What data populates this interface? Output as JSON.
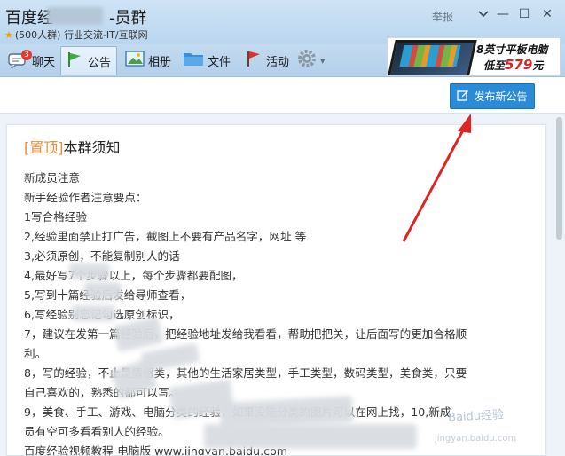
{
  "window": {
    "title_prefix": "百度经",
    "title_suffix": "-员群",
    "group_info": "(500人群) 行业交流-IT/互联网",
    "report_label": "举报",
    "minimize_glyph": "—",
    "maximize_glyph": "☐",
    "close_glyph": "✕"
  },
  "toolbar": {
    "tabs": [
      {
        "label": "聊天",
        "badge": "3"
      },
      {
        "label": "公告"
      },
      {
        "label": "相册"
      },
      {
        "label": "文件"
      },
      {
        "label": "活动"
      }
    ],
    "settings_dropdown_glyph": "▾"
  },
  "ad": {
    "line1": "8英寸平板电脑",
    "line2_prefix": "低至",
    "line2_price": "579",
    "line2_suffix": "元"
  },
  "announcement": {
    "publish_button": "发布新公告",
    "pin_tag": "[置顶]",
    "title": "本群须知",
    "lines": [
      "新成员注意",
      "新手经验作者注意要点：",
      "1写合格经验",
      "2,经验里面禁止打广告，截图上不要有产品名字，网址 等",
      "3,必须原创，不能复制别人的话",
      "4,最好写7个步骤以上，每个步骤都要配图，",
      "5,写到十篇经验后发给导师查看，",
      "6,写经验别忘记勾选原创标识，",
      "7，建议在发第一篇经验后，把经验地址发给我看看，帮助把把关，让后面写的更加合格顺",
      "利。",
      "8，写的经验，不止是情感类，其他的生活家居类型，手工类型，数码类型，美食类，只要",
      "自己喜欢的，熟悉的都可以写。",
      "9，美食、手工、游戏、电脑分类的经验，如果没能分类的图片可以在网上找，10,新成",
      "员有空可多看看别人的经验。",
      "百度经验视频教程-电脑版 www.jingyan.baidu.com"
    ]
  },
  "watermark": {
    "brand": "Baidu经验",
    "url": "jingyan.baidu.com"
  },
  "colors": {
    "accent": "#2b8bd6",
    "pin": "#f08a3c",
    "arrow": "#e02424"
  }
}
